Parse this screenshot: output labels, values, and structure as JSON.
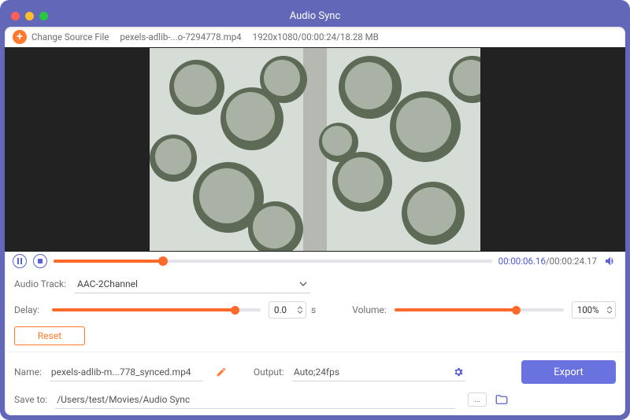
{
  "window": {
    "title": "Audio Sync"
  },
  "topbar": {
    "change_label": "Change Source File",
    "filename": "pexels-adlib-...o-7294778.mp4",
    "metadata": "1920x1080/00:00:24/18.28 MB"
  },
  "playback": {
    "current": "00:00:06.16",
    "total": "/00:00:24.17",
    "progress_percent": 25
  },
  "audio": {
    "track_label": "Audio Track:",
    "track_value": "AAC-2Channel",
    "delay_label": "Delay:",
    "delay_value": "0.0",
    "delay_unit": "s",
    "delay_percent": 88,
    "volume_label": "Volume:",
    "volume_value": "100%",
    "volume_percent": 72,
    "reset_label": "Reset"
  },
  "output": {
    "name_label": "Name:",
    "name_value": "pexels-adlib-m...778_synced.mp4",
    "output_label": "Output:",
    "output_value": "Auto;24fps",
    "save_label": "Save to:",
    "save_value": "/Users/test/Movies/Audio Sync",
    "export_label": "Export",
    "browse_label": "..."
  }
}
